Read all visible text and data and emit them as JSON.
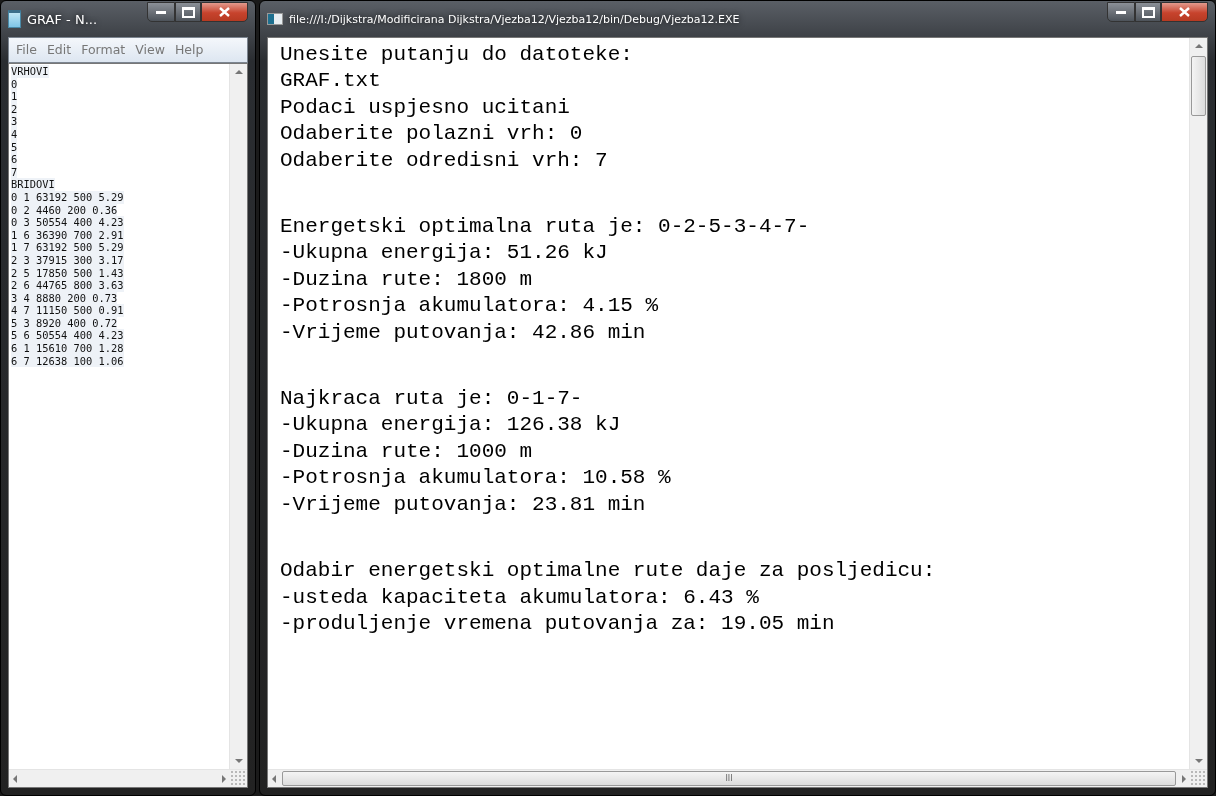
{
  "notepad": {
    "title": "GRAF - N...",
    "menu": [
      "File",
      "Edit",
      "Format",
      "View",
      "Help"
    ],
    "lines": [
      "VRHOVI",
      "0",
      "1",
      "2",
      "3",
      "4",
      "5",
      "6",
      "7",
      "BRIDOVI",
      "0 1 63192 500 5.29",
      "0 2 4460 200 0.36",
      "0 3 50554 400 4.23",
      "1 6 36390 700 2.91",
      "1 7 63192 500 5.29",
      "2 3 37915 300 3.17",
      "2 5 17850 500 1.43",
      "2 6 44765 800 3.63",
      "3 4 8880 200 0.73",
      "4 7 11150 500 0.91",
      "5 3 8920 400 0.72",
      "5 6 50554 400 4.23",
      "6 1 15610 700 1.28",
      "6 7 12638 100 1.06"
    ]
  },
  "console": {
    "title": "file:///I:/Dijkstra/Modificirana Dijkstra/Vjezba12/Vjezba12/bin/Debug/Vjezba12.EXE",
    "blocks": [
      [
        "Unesite putanju do datoteke:",
        "GRAF.txt",
        "Podaci uspjesno ucitani",
        "Odaberite polazni vrh: 0",
        "Odaberite odredisni vrh: 7"
      ],
      [
        "Energetski optimalna ruta je: 0-2-5-3-4-7-",
        "-Ukupna energija: 51.26 kJ",
        "-Duzina rute: 1800 m",
        "-Potrosnja akumulatora: 4.15 %",
        "-Vrijeme putovanja: 42.86 min"
      ],
      [
        "Najkraca ruta je: 0-1-7-",
        "-Ukupna energija: 126.38 kJ",
        "-Duzina rute: 1000 m",
        "-Potrosnja akumulatora: 10.58 %",
        "-Vrijeme putovanja: 23.81 min"
      ],
      [
        "Odabir energetski optimalne rute daje za posljedicu:",
        "-usteda kapaciteta akumulatora: 6.43 %",
        "-produljenje vremena putovanja za: 19.05 min"
      ]
    ],
    "hscroll_label": "III"
  }
}
